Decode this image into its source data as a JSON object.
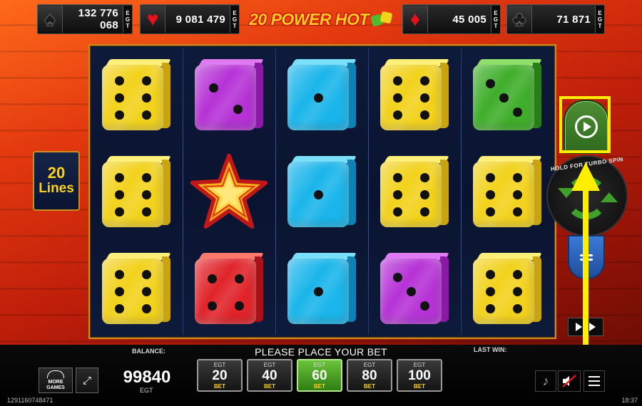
{
  "jackpots": [
    {
      "suit": "spade",
      "glyph": "♠",
      "amount": "132 776 068",
      "brand": "EGT"
    },
    {
      "suit": "heart",
      "glyph": "♥",
      "amount": "9 081 479",
      "brand": "EGT"
    },
    {
      "suit": "diamond",
      "glyph": "♦",
      "amount": "45 005",
      "brand": "EGT"
    },
    {
      "suit": "club",
      "glyph": "♣",
      "amount": "71 871",
      "brand": "EGT"
    }
  ],
  "game_title": "20 POWER HOT",
  "lines": {
    "count": "20",
    "label": "Lines"
  },
  "turbo_label": "HOLD FOR TURBO SPIN",
  "reels": [
    [
      "yellow-6",
      "yellow-6",
      "yellow-6"
    ],
    [
      "purple-2",
      "star",
      "red-4"
    ],
    [
      "cyan-1",
      "cyan-1",
      "cyan-1"
    ],
    [
      "yellow-6",
      "yellow-6",
      "purple-3"
    ],
    [
      "green-3",
      "yellow-6",
      "yellow-6"
    ]
  ],
  "bottom": {
    "balance_label": "BALANCE:",
    "balance_value": "99840",
    "balance_currency": "EGT",
    "message": "PLEASE PLACE YOUR BET",
    "last_win_label": "LAST WIN:",
    "more_games_label": "MORE\nGAMES",
    "ticket_id": "1291160748471",
    "clock": "18:37"
  },
  "bets": [
    {
      "brand": "EGT",
      "value": "20",
      "label": "BET",
      "active": false
    },
    {
      "brand": "EGT",
      "value": "40",
      "label": "BET",
      "active": false
    },
    {
      "brand": "EGT",
      "value": "60",
      "label": "BET",
      "active": true
    },
    {
      "brand": "EGT",
      "value": "80",
      "label": "BET",
      "active": false
    },
    {
      "brand": "EGT",
      "value": "100",
      "label": "BET",
      "active": false
    }
  ],
  "icons": {
    "spin": "spin-play-icon",
    "turbo": "turbo-spin-icon",
    "settings": "settings-icon",
    "autoplay": "autoplay-icon",
    "fullscreen": "fullscreen-icon",
    "music": "music-note-icon",
    "sound": "sound-muted-icon",
    "menu": "menu-icon"
  },
  "annotation_color": "#ffee00"
}
